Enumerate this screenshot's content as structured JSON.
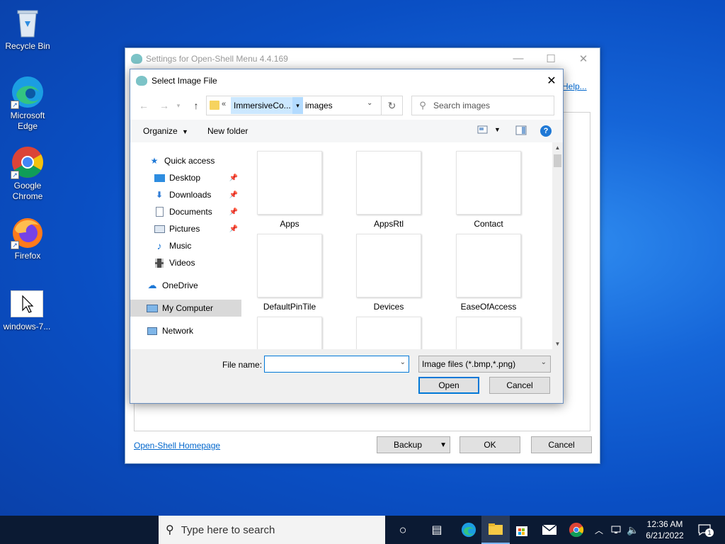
{
  "desktop": {
    "icons": [
      {
        "label": "Recycle Bin"
      },
      {
        "label": "Microsoft Edge"
      },
      {
        "label": "Google Chrome"
      },
      {
        "label": "Firefox"
      },
      {
        "label": "windows-7..."
      }
    ]
  },
  "settings_window": {
    "title": "Settings for Open-Shell Menu 4.4.169",
    "help_link": "Help...",
    "homepage_link": "Open-Shell Homepage",
    "backup_label": "Backup",
    "ok_label": "OK",
    "cancel_label": "Cancel"
  },
  "dialog": {
    "title": "Select Image File",
    "address": {
      "overflow": "«",
      "crumb_parent": "ImmersiveCo...",
      "crumb_current": "images"
    },
    "search_placeholder": "Search images",
    "toolbar": {
      "organize": "Organize",
      "new_folder": "New folder"
    },
    "nav_items": [
      {
        "label": "Quick access",
        "icon": "star-icon"
      },
      {
        "label": "Desktop",
        "icon": "desktop-icon",
        "pinned": true
      },
      {
        "label": "Downloads",
        "icon": "download-icon",
        "pinned": true
      },
      {
        "label": "Documents",
        "icon": "document-icon",
        "pinned": true
      },
      {
        "label": "Pictures",
        "icon": "pictures-icon",
        "pinned": true
      },
      {
        "label": "Music",
        "icon": "music-icon"
      },
      {
        "label": "Videos",
        "icon": "video-icon"
      },
      {
        "label": "OneDrive",
        "icon": "cloud-icon"
      },
      {
        "label": "My Computer",
        "icon": "computer-icon",
        "selected": true
      },
      {
        "label": "Network",
        "icon": "network-icon"
      }
    ],
    "files": [
      {
        "name": "Apps"
      },
      {
        "name": "AppsRtl"
      },
      {
        "name": "Contact"
      },
      {
        "name": "DefaultPinTile"
      },
      {
        "name": "Devices"
      },
      {
        "name": "EaseOfAccess"
      },
      {
        "name": ""
      },
      {
        "name": ""
      },
      {
        "name": ""
      }
    ],
    "file_name_label": "File name:",
    "file_name_value": "",
    "file_type": "Image files (*.bmp,*.png)",
    "open_label": "Open",
    "cancel_label": "Cancel"
  },
  "taskbar": {
    "search_placeholder": "Type here to search",
    "time": "12:36 AM",
    "date": "6/21/2022",
    "notification_count": "1"
  },
  "colors": {
    "accent": "#0078d7",
    "selection": "#cce8ff",
    "taskbar": "#0b1a33"
  }
}
